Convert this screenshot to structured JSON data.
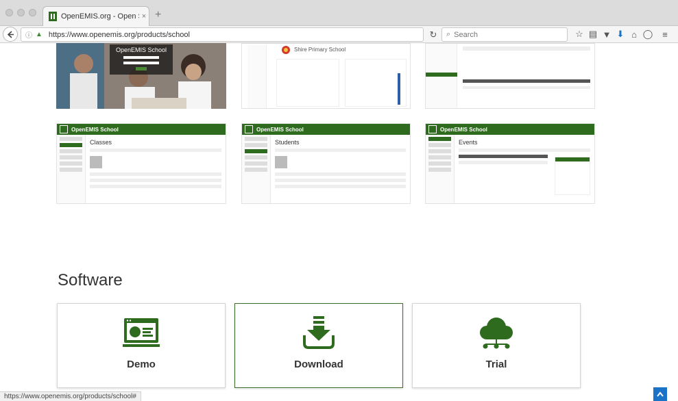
{
  "browser": {
    "tab_title": "OpenEMIS.org - Open Sour...",
    "tab_close": "×",
    "new_tab": "+",
    "url": "https://www.openemis.org/products/school",
    "search_placeholder": "Search",
    "status_url": "https://www.openemis.org/products/school#"
  },
  "screenshots": {
    "login": {
      "overlay_title": "OpenEMIS School"
    },
    "profile": {
      "school_name": "Shire Primary School"
    },
    "classes": {
      "brand": "OpenEMIS School",
      "page_title": "Classes"
    },
    "students": {
      "brand": "OpenEMIS School",
      "page_title": "Students"
    },
    "events": {
      "brand": "OpenEMIS School",
      "page_title": "Events"
    }
  },
  "software": {
    "title": "Software",
    "cards": [
      {
        "label": "Demo",
        "icon": "monitor-icon"
      },
      {
        "label": "Download",
        "icon": "download-icon"
      },
      {
        "label": "Trial",
        "icon": "cloud-icon"
      }
    ]
  },
  "colors": {
    "brand_green": "#2f6b1f",
    "accent_blue": "#1a73c7"
  }
}
